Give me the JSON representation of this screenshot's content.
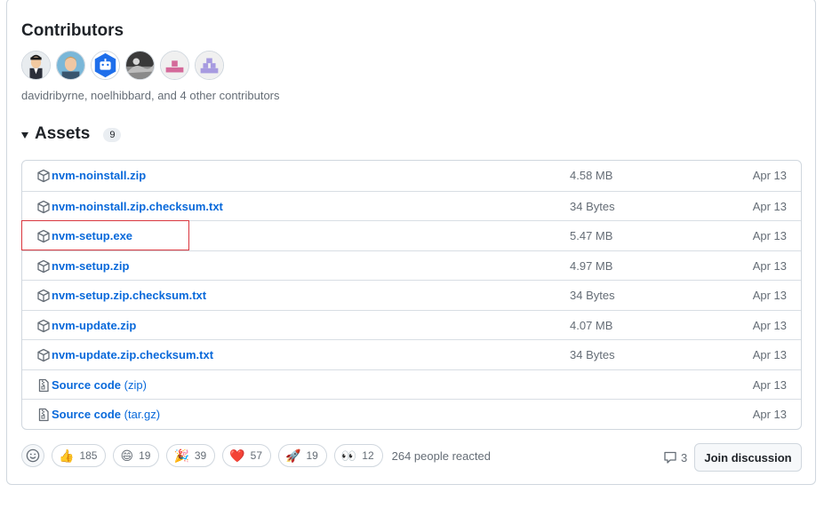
{
  "contributors": {
    "title": "Contributors",
    "summary": "davidribyrne, noelhibbard, and 4 other contributors"
  },
  "assets": {
    "title": "Assets",
    "count": "9",
    "rows": [
      {
        "name": "nvm-noinstall.zip",
        "ext": "",
        "size": "4.58 MB",
        "date": "Apr 13",
        "icon": "package-icon"
      },
      {
        "name": "nvm-noinstall.zip.checksum.txt",
        "ext": "",
        "size": "34 Bytes",
        "date": "Apr 13",
        "icon": "package-icon"
      },
      {
        "name": "nvm-setup.exe",
        "ext": "",
        "size": "5.47 MB",
        "date": "Apr 13",
        "icon": "package-icon"
      },
      {
        "name": "nvm-setup.zip",
        "ext": "",
        "size": "4.97 MB",
        "date": "Apr 13",
        "icon": "package-icon"
      },
      {
        "name": "nvm-setup.zip.checksum.txt",
        "ext": "",
        "size": "34 Bytes",
        "date": "Apr 13",
        "icon": "package-icon"
      },
      {
        "name": "nvm-update.zip",
        "ext": "",
        "size": "4.07 MB",
        "date": "Apr 13",
        "icon": "package-icon"
      },
      {
        "name": "nvm-update.zip.checksum.txt",
        "ext": "",
        "size": "34 Bytes",
        "date": "Apr 13",
        "icon": "package-icon"
      },
      {
        "name": "Source code",
        "ext": "(zip)",
        "size": "",
        "date": "Apr 13",
        "icon": "file-zip-icon"
      },
      {
        "name": "Source code",
        "ext": "(tar.gz)",
        "size": "",
        "date": "Apr 13",
        "icon": "file-zip-icon"
      }
    ]
  },
  "reactions": {
    "items": [
      {
        "emoji": "👍",
        "count": "185",
        "name": "thumbs-up"
      },
      {
        "emoji": "😄",
        "count": "19",
        "name": "laugh"
      },
      {
        "emoji": "🎉",
        "count": "39",
        "name": "hooray"
      },
      {
        "emoji": "❤️",
        "count": "57",
        "name": "heart"
      },
      {
        "emoji": "🚀",
        "count": "19",
        "name": "rocket"
      },
      {
        "emoji": "👀",
        "count": "12",
        "name": "eyes"
      }
    ],
    "summary": "264 people reacted"
  },
  "discussion": {
    "comment_count": "3",
    "join_label": "Join discussion"
  },
  "colors": {
    "link": "#0969da",
    "muted": "#656d76",
    "border": "#d0d7de",
    "highlight": "#d9363e"
  }
}
